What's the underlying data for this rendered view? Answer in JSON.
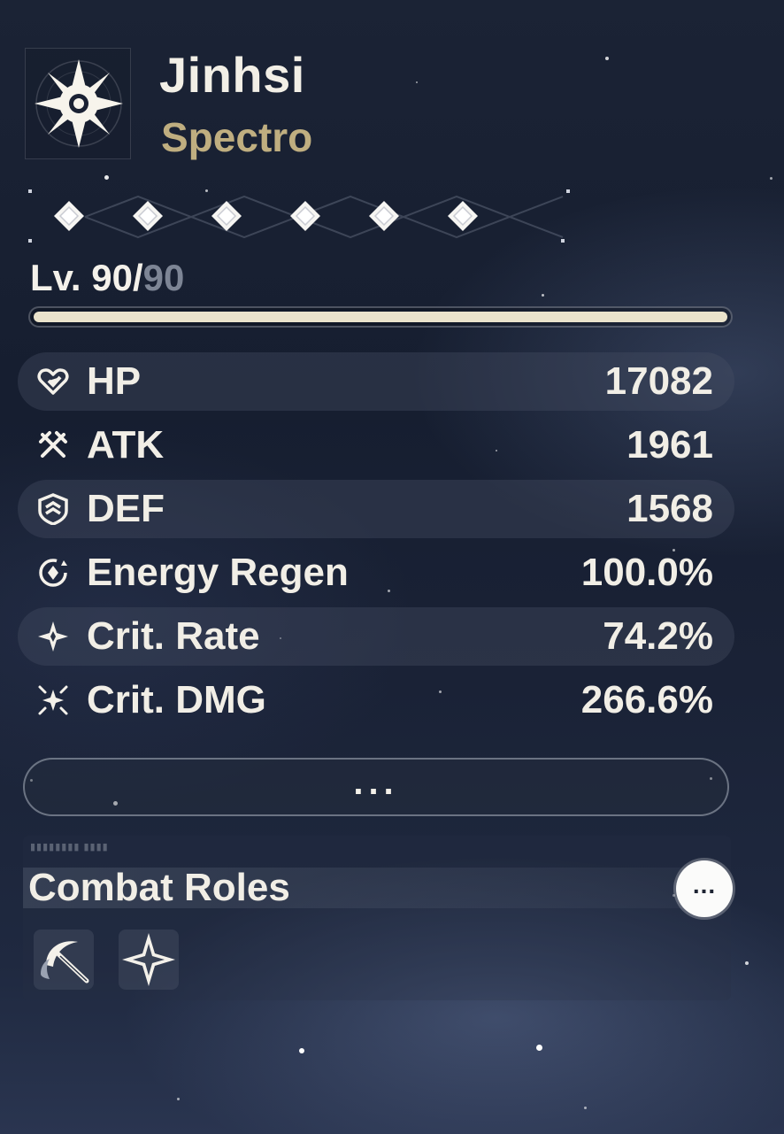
{
  "character": {
    "name": "Jinhsi",
    "element": "Spectro",
    "element_color": "#bfae80",
    "element_icon": "spectro-sun-icon"
  },
  "sequence": {
    "unlocked": 6,
    "total": 6,
    "node_icon": "diamond-icon"
  },
  "level": {
    "current": "Lv. 90/",
    "max": "90",
    "progress": 1.0
  },
  "stats": [
    {
      "label": "HP",
      "value": "17082",
      "icon": "hp-heart-icon"
    },
    {
      "label": "ATK",
      "value": "1961",
      "icon": "atk-crossed-swords-icon"
    },
    {
      "label": "DEF",
      "value": "1568",
      "icon": "def-shield-icon"
    },
    {
      "label": "Energy Regen",
      "value": "100.0%",
      "icon": "energy-regen-icon"
    },
    {
      "label": "Crit. Rate",
      "value": "74.2%",
      "icon": "crit-rate-icon"
    },
    {
      "label": "Crit. DMG",
      "value": "266.6%",
      "icon": "crit-dmg-icon"
    }
  ],
  "more_stats_label": "...",
  "combat_roles": {
    "title": "Combat Roles",
    "more_label": "...",
    "roles": [
      {
        "icon": "scythe-slash-icon"
      },
      {
        "icon": "four-point-star-icon"
      }
    ]
  }
}
